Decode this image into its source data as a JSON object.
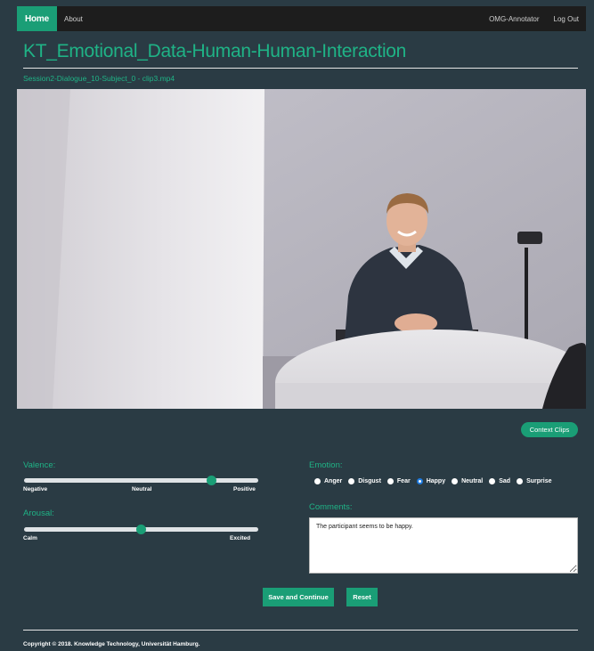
{
  "nav": {
    "home": "Home",
    "about": "About",
    "annotator": "OMG-Annotator",
    "logout": "Log Out"
  },
  "page": {
    "title": "KT_Emotional_Data-Human-Human-Interaction",
    "subtitle": "Session2-Dialogue_10-Subject_0 - clip3.mp4"
  },
  "context_button": "Context Clips",
  "valence": {
    "label": "Valence:",
    "value": 0.8,
    "ticks": [
      "Negative",
      "Neutral",
      "Positive"
    ]
  },
  "arousal": {
    "label": "Arousal:",
    "value": 0.5,
    "ticks": [
      "Calm",
      "Excited"
    ]
  },
  "emotion": {
    "label": "Emotion:",
    "options": [
      "Anger",
      "Disgust",
      "Fear",
      "Happy",
      "Neutral",
      "Sad",
      "Surprise"
    ],
    "selected": "Happy"
  },
  "comments": {
    "label": "Comments:",
    "value": "The participant seems to be happy."
  },
  "buttons": {
    "save": "Save and Continue",
    "reset": "Reset"
  },
  "footer": "Copyright © 2018. Knowledge Technology, Universität Hamburg.",
  "colors": {
    "accent": "#1a9e76",
    "background": "#2a3b44",
    "navbar": "#1d1d1d"
  }
}
